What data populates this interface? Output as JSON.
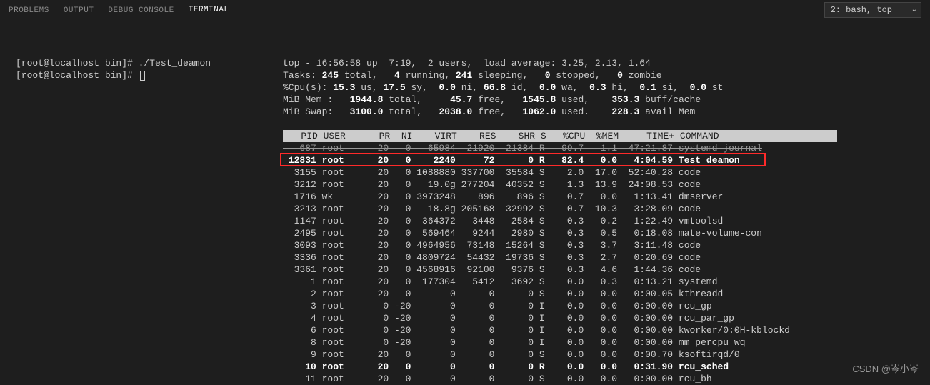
{
  "tabs": [
    "PROBLEMS",
    "OUTPUT",
    "DEBUG CONSOLE",
    "TERMINAL"
  ],
  "active_tab": "TERMINAL",
  "shell_selector": "2: bash, top",
  "left_lines": [
    "[root@localhost bin]# ./Test_deamon",
    "[root@localhost bin]# "
  ],
  "top_header": {
    "line1_a": "top - 16:56:58 up  7:19,  2 users,  load average: 3.25, 2.13, 1.64",
    "tasks": {
      "total": "245",
      "running": "4",
      "sleeping": "241",
      "stopped": "0",
      "zombie": "0"
    },
    "cpu": {
      "us": "15.3",
      "sy": "17.5",
      "ni": "0.0",
      "id": "66.8",
      "wa": "0.0",
      "hi": "0.3",
      "si": "0.1",
      "st": "0.0"
    },
    "mem": {
      "total": "1944.8",
      "free": "45.7",
      "used": "1545.8",
      "buff": "353.3"
    },
    "swap": {
      "total": "3100.0",
      "free": "2038.0",
      "used": "1062.0",
      "avail": "228.3"
    }
  },
  "columns": [
    "PID",
    "USER",
    "PR",
    "NI",
    "VIRT",
    "RES",
    "SHR",
    "S",
    "%CPU",
    "%MEM",
    "TIME+",
    "COMMAND"
  ],
  "rows": [
    {
      "pid": "687",
      "user": "root",
      "pr": "20",
      "ni": "0",
      "virt": "65984",
      "res": "21920",
      "shr": "21384",
      "s": "R",
      "cpu": "99.7",
      "mem": "1.1",
      "time": "47:21.87",
      "cmd": "systemd-journal",
      "strike": true
    },
    {
      "pid": "12831",
      "user": "root",
      "pr": "20",
      "ni": "0",
      "virt": "2240",
      "res": "72",
      "shr": "0",
      "s": "R",
      "cpu": "82.4",
      "mem": "0.0",
      "time": "4:04.59",
      "cmd": "Test_deamon",
      "bold": true,
      "highlight": true
    },
    {
      "pid": "3155",
      "user": "root",
      "pr": "20",
      "ni": "0",
      "virt": "1088880",
      "res": "337700",
      "shr": "35584",
      "s": "S",
      "cpu": "2.0",
      "mem": "17.0",
      "time": "52:40.28",
      "cmd": "code"
    },
    {
      "pid": "3212",
      "user": "root",
      "pr": "20",
      "ni": "0",
      "virt": "19.0g",
      "res": "277204",
      "shr": "40352",
      "s": "S",
      "cpu": "1.3",
      "mem": "13.9",
      "time": "24:08.53",
      "cmd": "code"
    },
    {
      "pid": "1716",
      "user": "wk",
      "pr": "20",
      "ni": "0",
      "virt": "3973248",
      "res": "896",
      "shr": "896",
      "s": "S",
      "cpu": "0.7",
      "mem": "0.0",
      "time": "1:13.41",
      "cmd": "dmserver"
    },
    {
      "pid": "3213",
      "user": "root",
      "pr": "20",
      "ni": "0",
      "virt": "18.8g",
      "res": "205168",
      "shr": "32992",
      "s": "S",
      "cpu": "0.7",
      "mem": "10.3",
      "time": "3:28.09",
      "cmd": "code"
    },
    {
      "pid": "1147",
      "user": "root",
      "pr": "20",
      "ni": "0",
      "virt": "364372",
      "res": "3448",
      "shr": "2584",
      "s": "S",
      "cpu": "0.3",
      "mem": "0.2",
      "time": "1:22.49",
      "cmd": "vmtoolsd"
    },
    {
      "pid": "2495",
      "user": "root",
      "pr": "20",
      "ni": "0",
      "virt": "569464",
      "res": "9244",
      "shr": "2980",
      "s": "S",
      "cpu": "0.3",
      "mem": "0.5",
      "time": "0:18.08",
      "cmd": "mate-volume-con"
    },
    {
      "pid": "3093",
      "user": "root",
      "pr": "20",
      "ni": "0",
      "virt": "4964956",
      "res": "73148",
      "shr": "15264",
      "s": "S",
      "cpu": "0.3",
      "mem": "3.7",
      "time": "3:11.48",
      "cmd": "code"
    },
    {
      "pid": "3336",
      "user": "root",
      "pr": "20",
      "ni": "0",
      "virt": "4809724",
      "res": "54432",
      "shr": "19736",
      "s": "S",
      "cpu": "0.3",
      "mem": "2.7",
      "time": "0:20.69",
      "cmd": "code"
    },
    {
      "pid": "3361",
      "user": "root",
      "pr": "20",
      "ni": "0",
      "virt": "4568916",
      "res": "92100",
      "shr": "9376",
      "s": "S",
      "cpu": "0.3",
      "mem": "4.6",
      "time": "1:44.36",
      "cmd": "code"
    },
    {
      "pid": "1",
      "user": "root",
      "pr": "20",
      "ni": "0",
      "virt": "177304",
      "res": "5412",
      "shr": "3692",
      "s": "S",
      "cpu": "0.0",
      "mem": "0.3",
      "time": "0:13.21",
      "cmd": "systemd"
    },
    {
      "pid": "2",
      "user": "root",
      "pr": "20",
      "ni": "0",
      "virt": "0",
      "res": "0",
      "shr": "0",
      "s": "S",
      "cpu": "0.0",
      "mem": "0.0",
      "time": "0:00.05",
      "cmd": "kthreadd"
    },
    {
      "pid": "3",
      "user": "root",
      "pr": "0",
      "ni": "-20",
      "virt": "0",
      "res": "0",
      "shr": "0",
      "s": "I",
      "cpu": "0.0",
      "mem": "0.0",
      "time": "0:00.00",
      "cmd": "rcu_gp"
    },
    {
      "pid": "4",
      "user": "root",
      "pr": "0",
      "ni": "-20",
      "virt": "0",
      "res": "0",
      "shr": "0",
      "s": "I",
      "cpu": "0.0",
      "mem": "0.0",
      "time": "0:00.00",
      "cmd": "rcu_par_gp"
    },
    {
      "pid": "6",
      "user": "root",
      "pr": "0",
      "ni": "-20",
      "virt": "0",
      "res": "0",
      "shr": "0",
      "s": "I",
      "cpu": "0.0",
      "mem": "0.0",
      "time": "0:00.00",
      "cmd": "kworker/0:0H-kblockd"
    },
    {
      "pid": "8",
      "user": "root",
      "pr": "0",
      "ni": "-20",
      "virt": "0",
      "res": "0",
      "shr": "0",
      "s": "I",
      "cpu": "0.0",
      "mem": "0.0",
      "time": "0:00.00",
      "cmd": "mm_percpu_wq"
    },
    {
      "pid": "9",
      "user": "root",
      "pr": "20",
      "ni": "0",
      "virt": "0",
      "res": "0",
      "shr": "0",
      "s": "S",
      "cpu": "0.0",
      "mem": "0.0",
      "time": "0:00.70",
      "cmd": "ksoftirqd/0"
    },
    {
      "pid": "10",
      "user": "root",
      "pr": "20",
      "ni": "0",
      "virt": "0",
      "res": "0",
      "shr": "0",
      "s": "R",
      "cpu": "0.0",
      "mem": "0.0",
      "time": "0:31.90",
      "cmd": "rcu_sched",
      "bold": true
    },
    {
      "pid": "11",
      "user": "root",
      "pr": "20",
      "ni": "0",
      "virt": "0",
      "res": "0",
      "shr": "0",
      "s": "S",
      "cpu": "0.0",
      "mem": "0.0",
      "time": "0:00.00",
      "cmd": "rcu_bh"
    }
  ],
  "watermark": "CSDN @岑小岑"
}
